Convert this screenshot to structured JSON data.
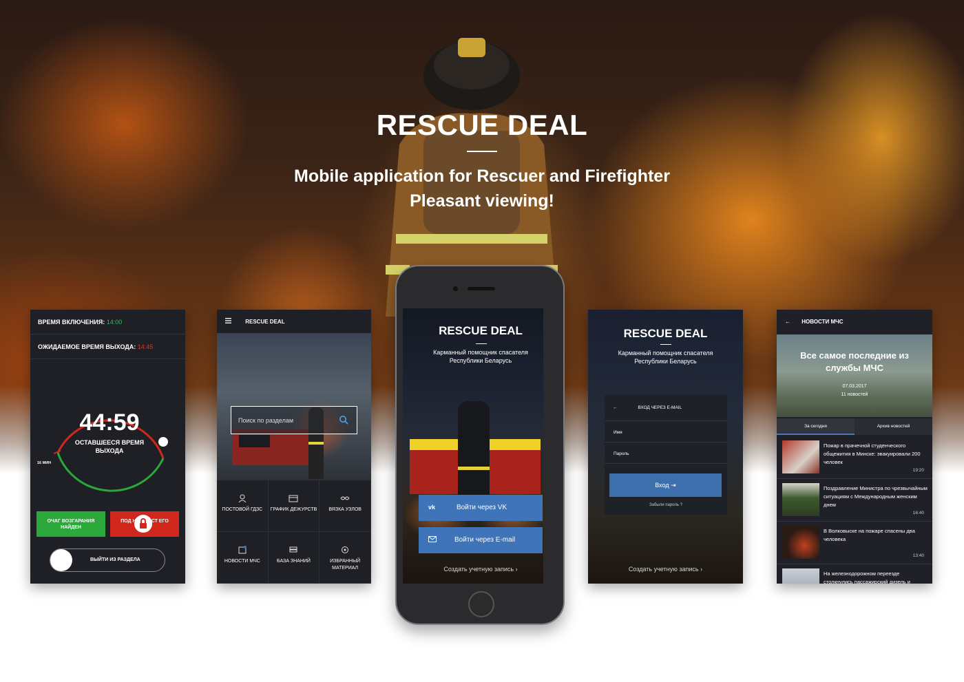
{
  "hero": {
    "title": "RESCUE DEAL",
    "subtitle_line1": "Mobile application for Rescuer and Firefighter",
    "subtitle_line2": "Pleasant viewing!"
  },
  "timer_screen": {
    "start_label": "ВРЕМЯ ВКЛЮЧЕНИЯ:",
    "start_value": "14:00",
    "exit_label": "ОЖИДАЕМОЕ ВРЕМЯ ВЫХОДА:",
    "exit_value": "14:45",
    "time": "44:59",
    "time_caption": "ОСТАВШЕЕСЯ ВРЕМЯ ВЫХОДА",
    "min_marker": "16 МИН",
    "btn_fire_found": "ОЧАГ ВОЗГАРАНИЯ НАЙДЕН",
    "btn_red": "ПОД НИЕ ПОСТ ЕГО",
    "toggle_label": "ВЫЙТИ ИЗ РАЗДЕЛА",
    "colors": {
      "green": "#2ec24a",
      "red": "#e0382c"
    }
  },
  "menu_screen": {
    "title": "RESCUE DEAL",
    "search_placeholder": "Поиск по разделам",
    "items": [
      {
        "label": "ПОСТОВОЙ ГДЗС",
        "icon": "firefighter-icon"
      },
      {
        "label": "ГРАФИК ДЕЖУРСТВ",
        "icon": "calendar-icon"
      },
      {
        "label": "ВЯЗКА УЗЛОВ",
        "icon": "knot-icon"
      },
      {
        "label": "НОВОСТИ МЧС",
        "icon": "news-icon"
      },
      {
        "label": "БАЗА ЗНАНИЙ",
        "icon": "books-icon"
      },
      {
        "label": "ИЗБРАННЫЙ МАТЕРИАЛ",
        "icon": "star-icon"
      }
    ]
  },
  "phone_screen": {
    "title": "RESCUE DEAL",
    "subtitle": "Карманный помощник спасателя Республики Беларусь",
    "btn_vk": "Войти через VK",
    "btn_email": "Войти через E-mail",
    "create_account": "Создать учетную запись"
  },
  "login_screen": {
    "title": "RESCUE DEAL",
    "subtitle": "Карманный помощник спасателя Республики Беларусь",
    "form_header": "ВХОД ЧЕРЕЗ E-MAIL",
    "field_name": "Имя",
    "field_password": "Пароль",
    "btn_enter": "Вход",
    "forgot": "Забыли пароль ?",
    "create_account": "Создать учетную запись"
  },
  "news_screen": {
    "title": "НОВОСТИ МЧС",
    "banner_title": "Все самое последние из службы МЧС",
    "banner_date": "07.03.2017",
    "banner_count": "11 новостей",
    "tab_today": "За сегодня",
    "tab_archive": "Архив новостей",
    "items": [
      {
        "text": "Пожар в прачечной студенческого общежития в Минске: эвакуировали 200 человек",
        "time": "19:20"
      },
      {
        "text": "Поздравление Министра по чрезвычайным ситуациям с Международным женским днем",
        "time": "16:40"
      },
      {
        "text": "В Волковыске на пожаре спасены два человека",
        "time": "13:40"
      },
      {
        "text": "На железнодорожном переезде столкнулись пассажирский дизель и",
        "time": ""
      }
    ]
  }
}
